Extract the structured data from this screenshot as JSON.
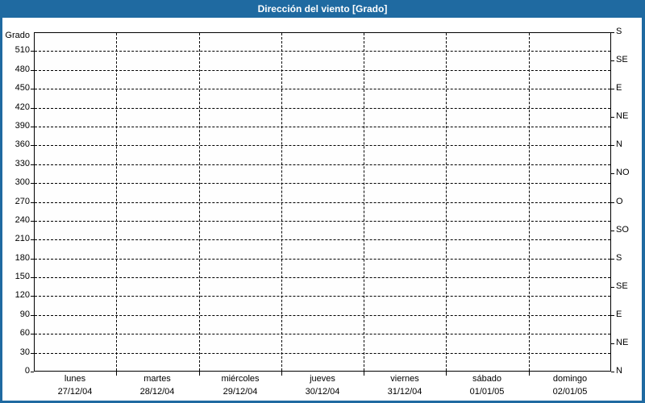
{
  "title_bar": {
    "title": "Dirección del viento [Grado]",
    "background": "#1f6aa1",
    "text_color": "#ffffff"
  },
  "frame": {
    "border_color": "#1f6aa1",
    "panel_background": "#ffffff"
  },
  "chart_data": {
    "type": "line",
    "title": "Dirección del viento [Grado]",
    "grid": {
      "style": "dashed",
      "color": "#000000",
      "on": true
    },
    "plot_background": "#fefefe",
    "axis_color": "#000000",
    "y_axis_left": {
      "label": "Grado",
      "min": 0,
      "max": 540,
      "tick_step": 30,
      "ticks": [
        0,
        30,
        60,
        90,
        120,
        150,
        180,
        210,
        240,
        270,
        300,
        330,
        360,
        390,
        420,
        450,
        480,
        510
      ]
    },
    "y_axis_right": {
      "ticks": [
        {
          "value": 0,
          "label": "N"
        },
        {
          "value": 45,
          "label": "NE"
        },
        {
          "value": 90,
          "label": "E"
        },
        {
          "value": 135,
          "label": "SE"
        },
        {
          "value": 180,
          "label": "S"
        },
        {
          "value": 225,
          "label": "SO"
        },
        {
          "value": 270,
          "label": "O"
        },
        {
          "value": 315,
          "label": "NO"
        },
        {
          "value": 360,
          "label": "N"
        },
        {
          "value": 405,
          "label": "NE"
        },
        {
          "value": 450,
          "label": "E"
        },
        {
          "value": 495,
          "label": "SE"
        },
        {
          "value": 540,
          "label": "S"
        }
      ]
    },
    "x_axis": {
      "days": [
        {
          "name": "lunes",
          "date": "27/12/04"
        },
        {
          "name": "martes",
          "date": "28/12/04"
        },
        {
          "name": "miércoles",
          "date": "29/12/04"
        },
        {
          "name": "jueves",
          "date": "30/12/04"
        },
        {
          "name": "viernes",
          "date": "31/12/04"
        },
        {
          "name": "sábado",
          "date": "01/01/05"
        },
        {
          "name": "domingo",
          "date": "02/01/05"
        }
      ]
    },
    "series": []
  }
}
